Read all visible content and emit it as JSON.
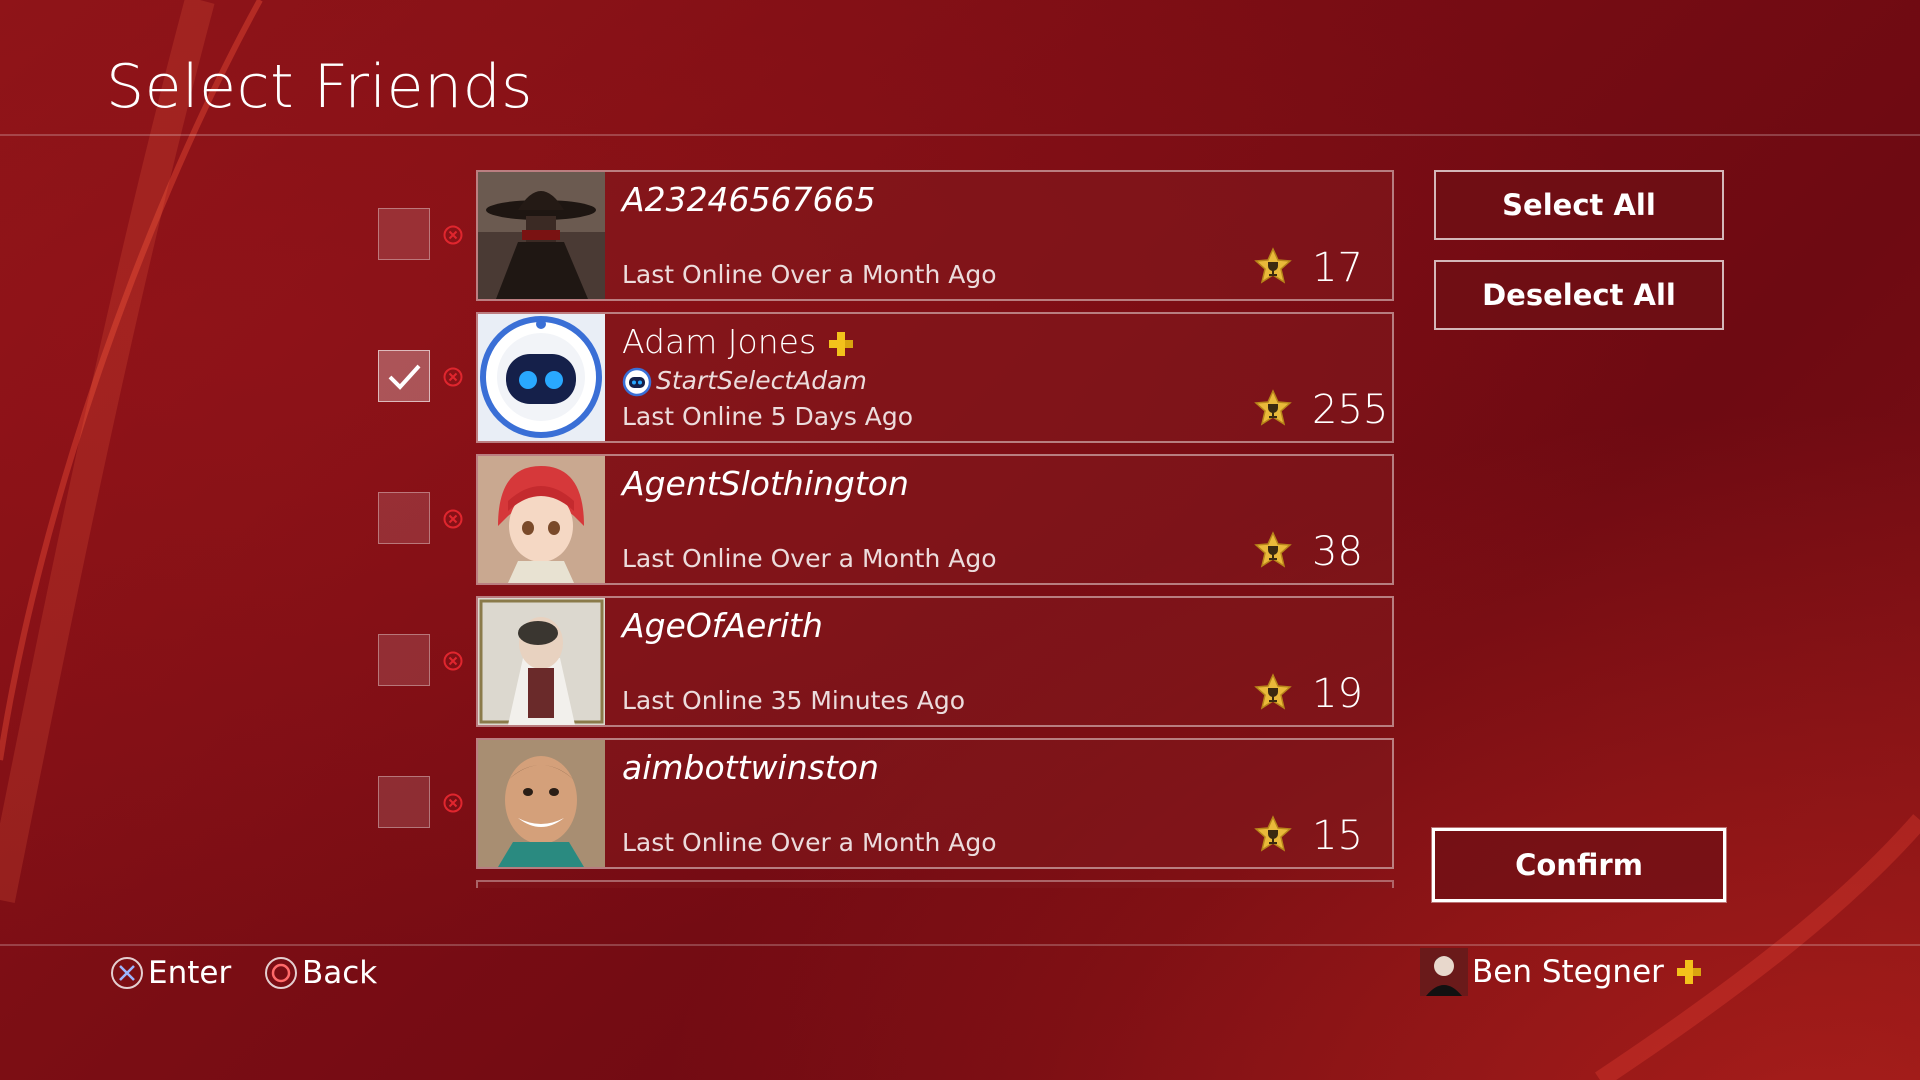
{
  "header": {
    "title": "Select Friends"
  },
  "friends": [
    {
      "name": "A23246567665",
      "last_online": "Last Online Over a Month Ago",
      "level": "17",
      "checked": false
    },
    {
      "name": "Adam Jones",
      "online_id": "StartSelectAdam",
      "last_online": "Last Online 5 Days Ago",
      "level": "255",
      "checked": true,
      "plus_member": true
    },
    {
      "name": "AgentSlothington",
      "last_online": "Last Online Over a Month Ago",
      "level": "38",
      "checked": false
    },
    {
      "name": "AgeOfAerith",
      "last_online": "Last Online 35 Minutes Ago",
      "level": "19",
      "checked": false
    },
    {
      "name": "aimbottwinston",
      "last_online": "Last Online Over a Month Ago",
      "level": "15",
      "checked": false
    }
  ],
  "actions": {
    "select_all": "Select All",
    "deselect_all": "Deselect All",
    "confirm": "Confirm"
  },
  "footer": {
    "enter_label": "Enter",
    "back_label": "Back",
    "user_name": "Ben Stegner"
  },
  "icons": {
    "enter": "cross-button-icon",
    "back": "circle-button-icon",
    "trophy": "trophy-icon",
    "plus": "playstation-plus-icon",
    "remove": "remove-icon"
  },
  "colors": {
    "background": "#7a0d14",
    "plus_gold": "#f3c21b",
    "remove_red": "#e0262e"
  }
}
